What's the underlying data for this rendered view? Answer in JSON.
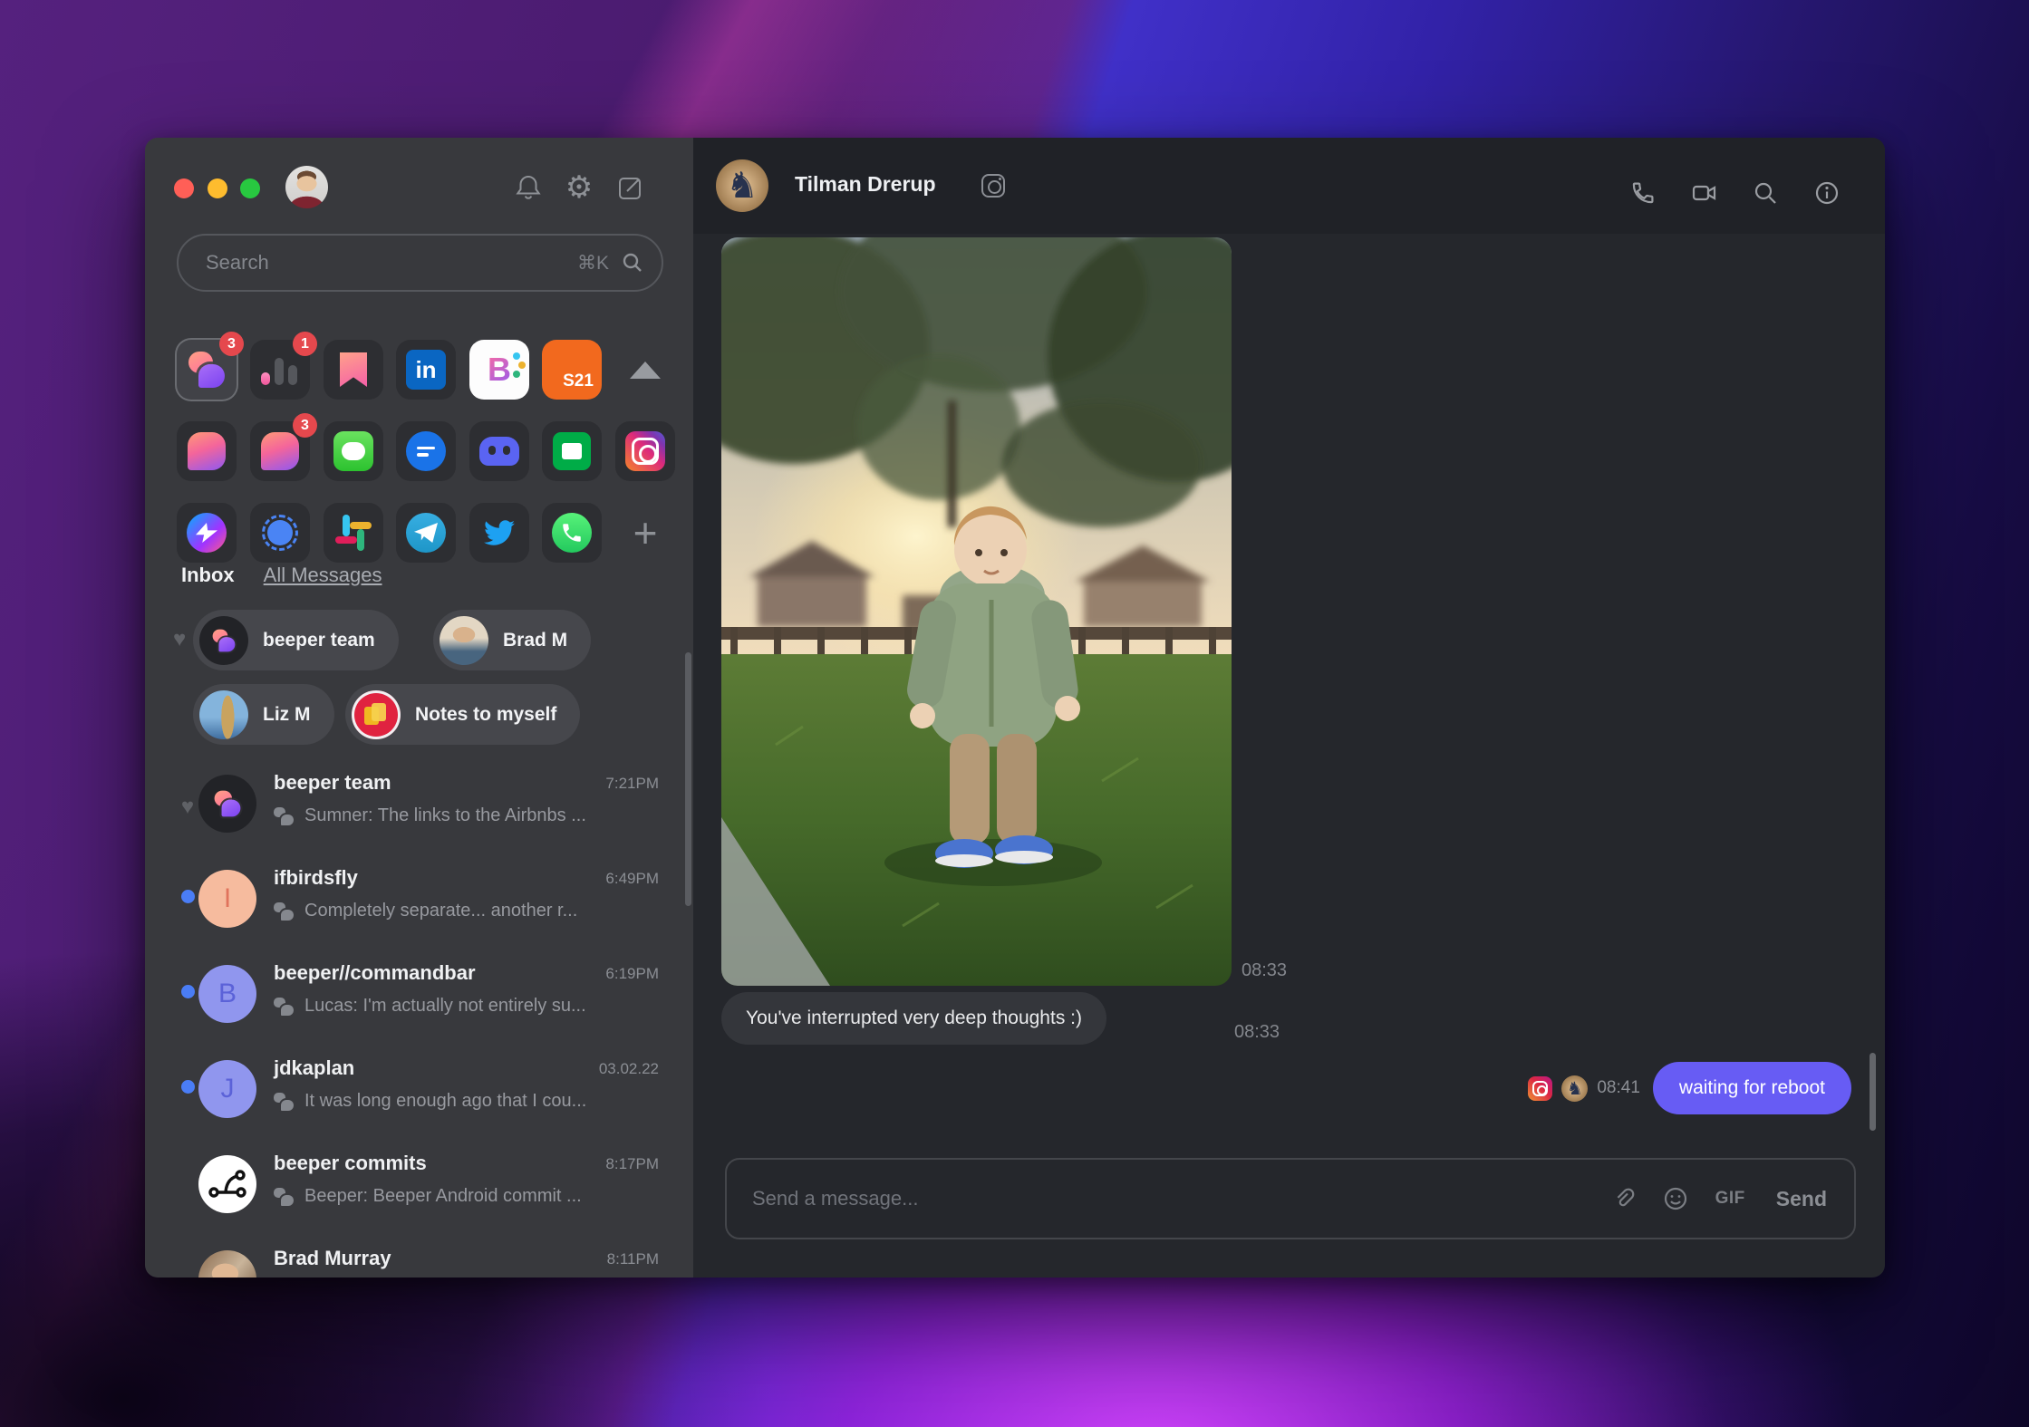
{
  "colors": {
    "accent_sent_bubble": "#675cf4",
    "badge_red": "#e5484d",
    "unread_dot_blue": "#4a7df6",
    "sidebar_bg": "#38393d",
    "chat_bg": "#25272c",
    "traffic_red": "#ff5f57",
    "traffic_yellow": "#febc2e",
    "traffic_green": "#28c840"
  },
  "icons": {
    "gear": "⚙",
    "heart": "♥",
    "plus": "+",
    "knight_avatar": "♞"
  },
  "sidebar": {
    "search": {
      "placeholder": "Search",
      "shortcut": "⌘K"
    },
    "networks": {
      "badges": {
        "beeper": "3",
        "activity": "1",
        "beeper_chat": "3"
      },
      "linkedin_label": "in",
      "beeper_b_label": "B",
      "s21_label": "S21"
    },
    "inbox_label": "Inbox",
    "all_messages_label": "All Messages",
    "favorites": [
      {
        "label": "beeper team"
      },
      {
        "label": "Brad M"
      },
      {
        "label": "Liz M"
      },
      {
        "label": "Notes to myself"
      }
    ],
    "chats": [
      {
        "name": "beeper team",
        "time": "7:21PM",
        "preview": "Sumner: The links to the Airbnbs ..."
      },
      {
        "name": "ifbirdsfly",
        "time": "6:49PM",
        "preview": "Completely separate... another r...",
        "initial": "I"
      },
      {
        "name": "beeper//commandbar",
        "time": "6:19PM",
        "preview": "Lucas: I'm actually not entirely su...",
        "initial": "B"
      },
      {
        "name": "jdkaplan",
        "time": "03.02.22",
        "preview": "It was long enough ago that I cou...",
        "initial": "J"
      },
      {
        "name": "beeper commits",
        "time": "8:17PM",
        "preview": "Beeper: Beeper Android commit ..."
      },
      {
        "name": "Brad Murray",
        "time": "8:11PM",
        "preview": ""
      }
    ]
  },
  "chat": {
    "title": "Tilman Drerup",
    "messages": {
      "photo_time": "08:33",
      "bubble_text": "You've interrupted very deep thoughts :)",
      "bubble_time": "08:33",
      "sent_time": "08:41",
      "sent_text": "waiting for reboot"
    },
    "composer": {
      "placeholder": "Send a message...",
      "gif_label": "GIF",
      "send_label": "Send"
    }
  }
}
